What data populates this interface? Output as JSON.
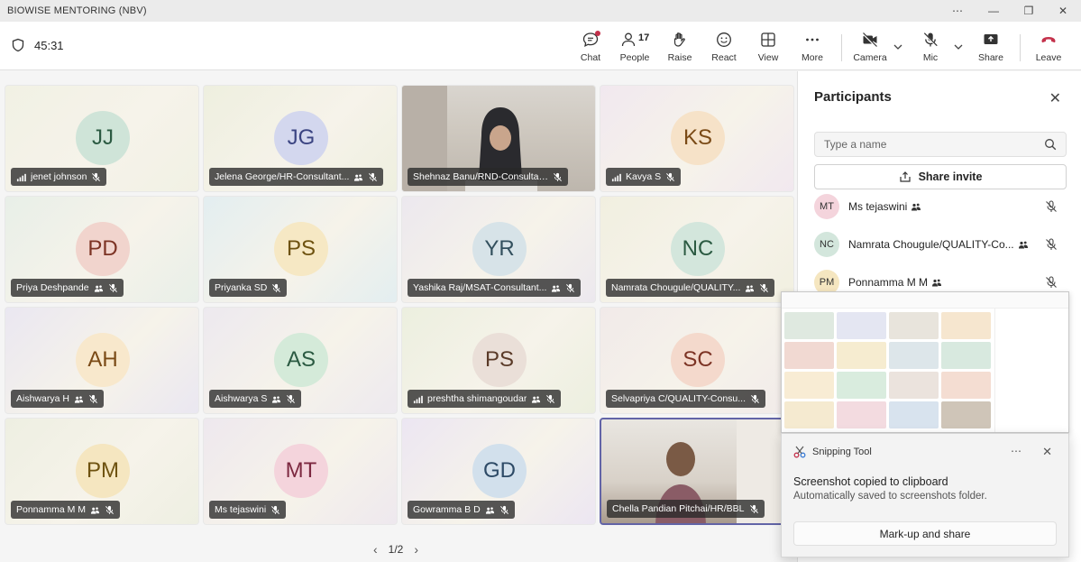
{
  "window": {
    "title": "BIOWISE MENTORING (NBV)"
  },
  "meeting": {
    "timer": "45:31",
    "toolbar": {
      "chat": "Chat",
      "people": "People",
      "people_count": "17",
      "raise": "Raise",
      "react": "React",
      "view": "View",
      "more": "More",
      "camera": "Camera",
      "mic": "Mic",
      "share": "Share",
      "leave": "Leave"
    }
  },
  "tiles": [
    {
      "initials": "JJ",
      "name": "jenet johnson",
      "bg": "#f1f1e4",
      "avatar_bg": "#cfe4d8",
      "avatar_fg": "#2b5a42",
      "signal": true
    },
    {
      "initials": "JG",
      "name": "Jelena George/HR-Consultant...",
      "bg": "#eeefdf",
      "avatar_bg": "#d3d7ee",
      "avatar_fg": "#3b4482",
      "hand": true
    },
    {
      "initials": "",
      "name": "Shehnaz Banu/RND-Consultants/...",
      "video": true
    },
    {
      "initials": "KS",
      "name": "Kavya S",
      "bg": "#f1e8ef",
      "avatar_bg": "#f6e2c8",
      "avatar_fg": "#7a4a16",
      "signal": true
    },
    {
      "initials": "PD",
      "name": "Priya Deshpande",
      "bg": "#e8efe8",
      "avatar_bg": "#f1d4cd",
      "avatar_fg": "#7c3324",
      "hand": true
    },
    {
      "initials": "PS",
      "name": "Priyanka SD",
      "bg": "#e3eef0",
      "avatar_bg": "#f6e8c4",
      "avatar_fg": "#6e5210"
    },
    {
      "initials": "YR",
      "name": "Yashika Raj/MSAT-Consultant...",
      "bg": "#ece8ee",
      "avatar_bg": "#d7e3e8",
      "avatar_fg": "#33505e",
      "hand": true
    },
    {
      "initials": "NC",
      "name": "Namrata Chougule/QUALITY...",
      "bg": "#f1efe0",
      "avatar_bg": "#d3e6dc",
      "avatar_fg": "#2b5a42",
      "hand": true
    },
    {
      "initials": "AH",
      "name": "Aishwarya H",
      "bg": "#eae7f1",
      "avatar_bg": "#f8e8cc",
      "avatar_fg": "#7a4a16",
      "hand": true
    },
    {
      "initials": "AS",
      "name": "Aishwarya S",
      "bg": "#ede9ef",
      "avatar_bg": "#d4ead9",
      "avatar_fg": "#2b5a42",
      "hand": true
    },
    {
      "initials": "PS",
      "name": "preshtha shimangoudar",
      "bg": "#ecefdf",
      "avatar_bg": "#eadfd8",
      "avatar_fg": "#5a3a28",
      "signal": true,
      "hand": true
    },
    {
      "initials": "SC",
      "name": "Selvapriya C/QUALITY-Consu...",
      "bg": "#f1eae9",
      "avatar_bg": "#f4d9cc",
      "avatar_fg": "#7c3324"
    },
    {
      "initials": "PM",
      "name": "Ponnamma M M",
      "bg": "#eeefe2",
      "avatar_bg": "#f5e6c0",
      "avatar_fg": "#6e5210",
      "hand": true
    },
    {
      "initials": "MT",
      "name": "Ms tejaswini",
      "bg": "#eee8ee",
      "avatar_bg": "#f4d4dc",
      "avatar_fg": "#7c2840"
    },
    {
      "initials": "GD",
      "name": "Gowramma B D",
      "bg": "#ece6f2",
      "avatar_bg": "#d2e0ec",
      "avatar_fg": "#2d4a66",
      "hand": true
    },
    {
      "initials": "",
      "name": "Chella Pandian Pitchai/HR/BBL",
      "video": true,
      "active": true
    }
  ],
  "pager": {
    "label": "1/2"
  },
  "participants": {
    "title": "Participants",
    "search_placeholder": "Type a name",
    "share_invite": "Share invite",
    "list": [
      {
        "initials": "MT",
        "name": "Ms tejaswini",
        "bg": "#f4d4dc"
      },
      {
        "initials": "NC",
        "name": "Namrata Chougule/QUALITY-Co...",
        "bg": "#d3e6dc"
      },
      {
        "initials": "PM",
        "name": "Ponnamma M M",
        "bg": "#f5e6c0"
      }
    ]
  },
  "snipping": {
    "app": "Snipping Tool",
    "message": "Screenshot copied to clipboard",
    "detail": "Automatically saved to screenshots folder.",
    "action": "Mark-up and share"
  },
  "colors": {
    "accent": "#5b5fc7",
    "leave": "#c4314b"
  },
  "icons": [
    "shield-icon",
    "chat-icon",
    "people-icon",
    "raise-hand-icon",
    "react-icon",
    "view-icon",
    "more-icon",
    "camera-off-icon",
    "mic-off-icon",
    "share-icon",
    "leave-icon",
    "search-icon",
    "close-icon",
    "snipping-tool-icon"
  ]
}
